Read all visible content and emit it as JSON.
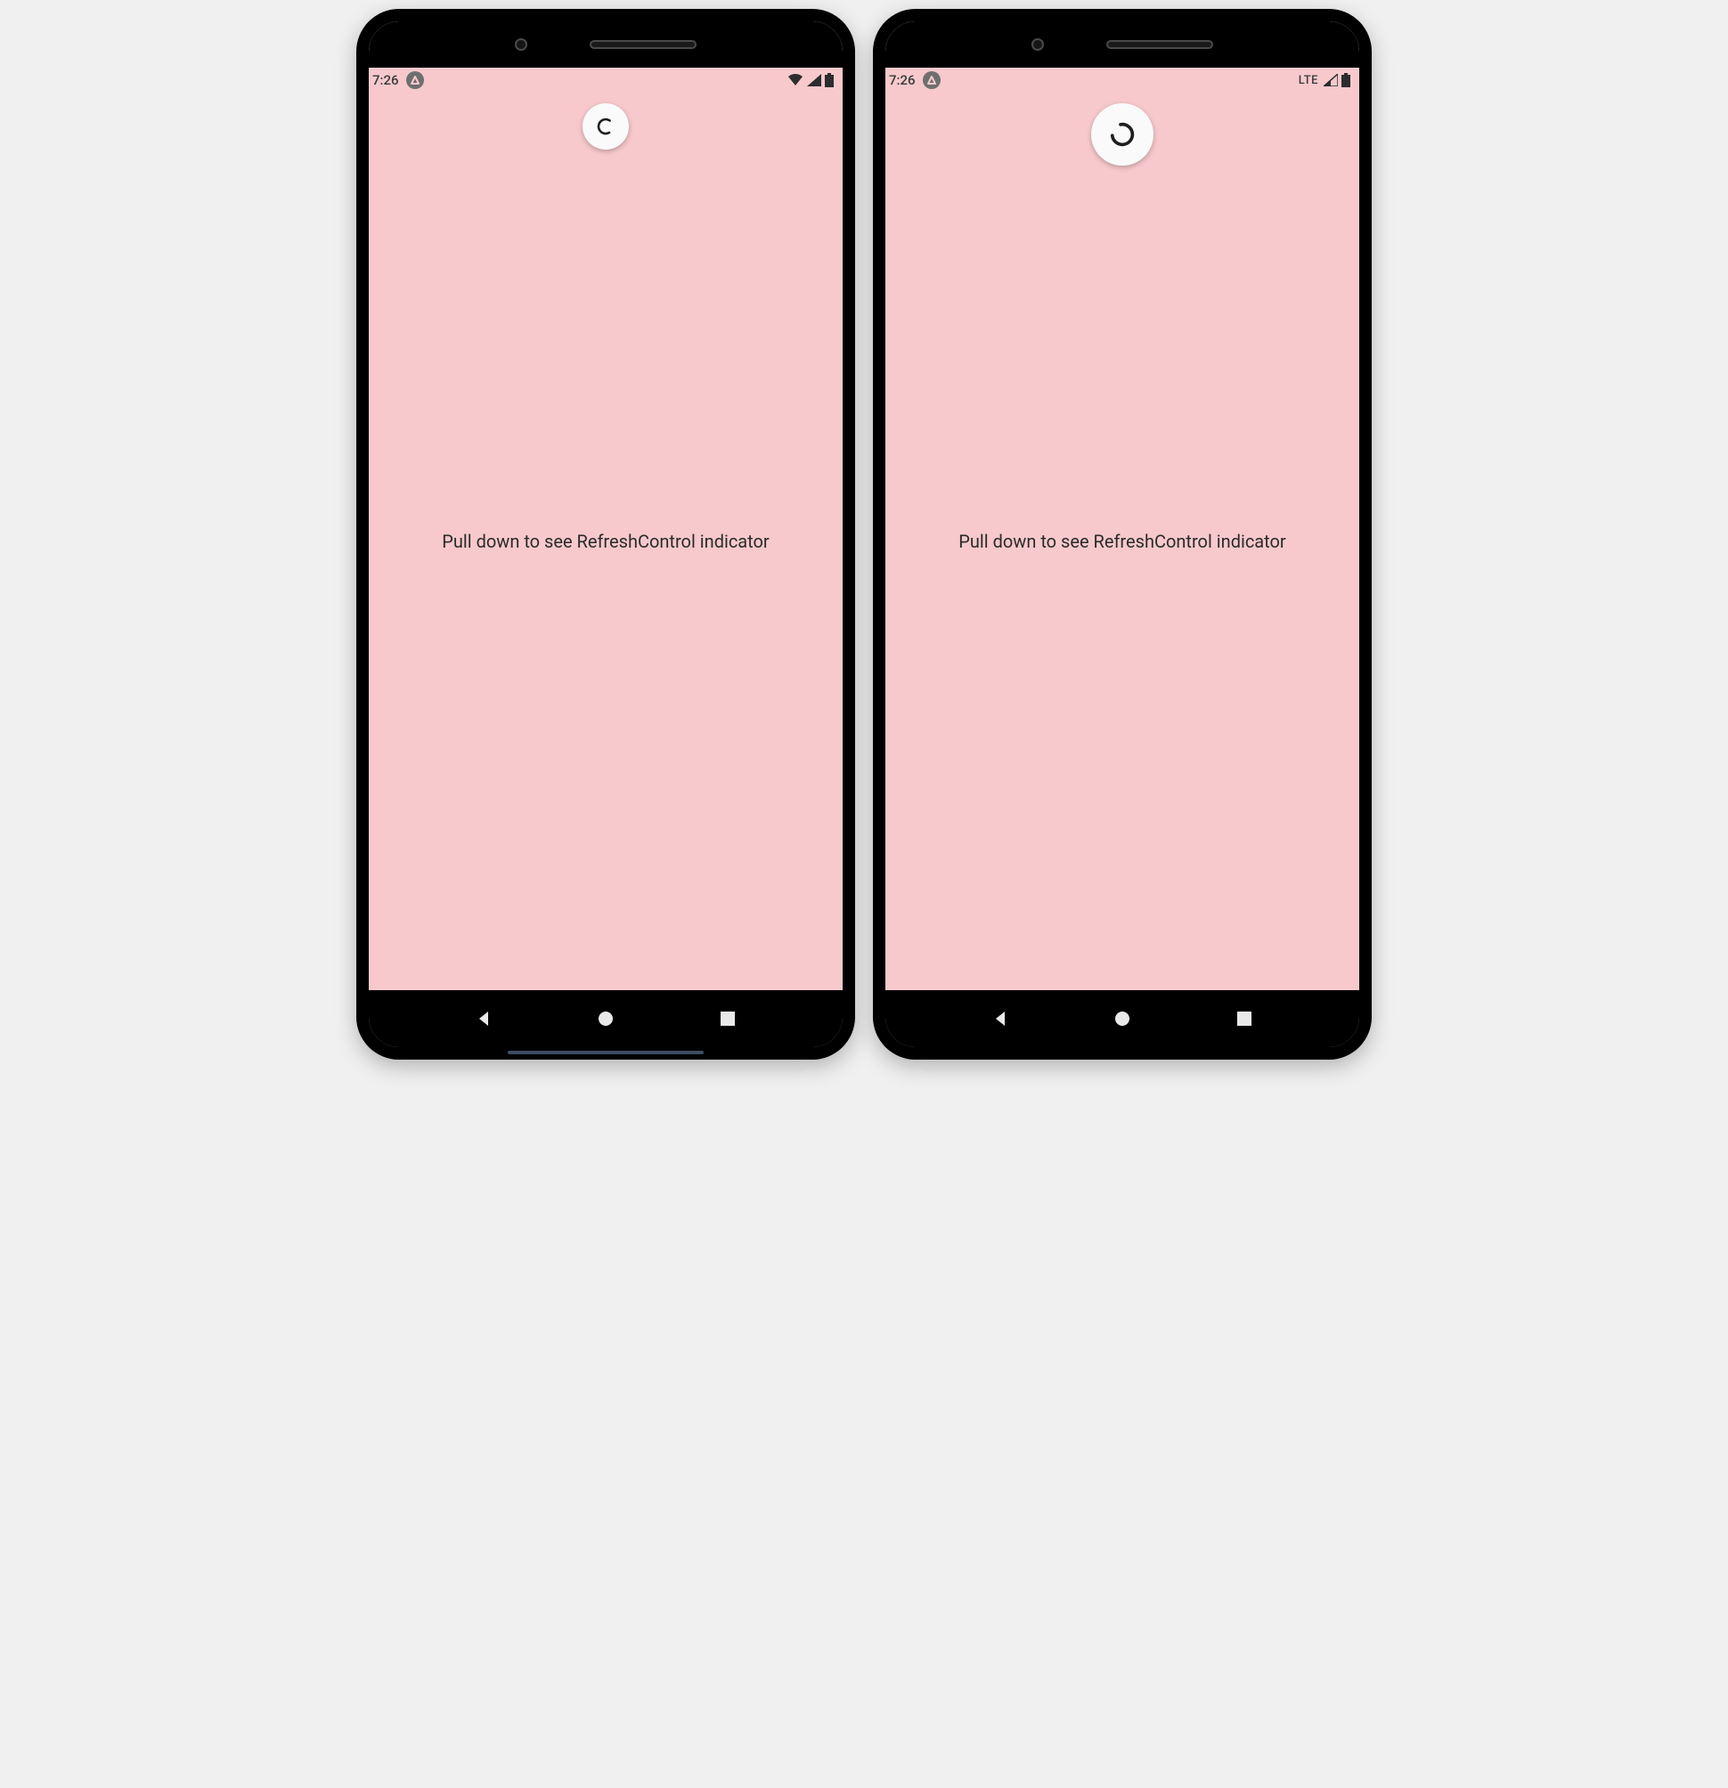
{
  "phones": [
    {
      "status": {
        "time": "7:26",
        "badge": "^",
        "right_mode": "wifi"
      },
      "refresh": {
        "size": "small"
      },
      "hint": "Pull down to see RefreshControl indicator",
      "show_home_indicator": true
    },
    {
      "status": {
        "time": "7:26",
        "badge": "^",
        "right_mode": "lte",
        "lte_label": "LTE"
      },
      "refresh": {
        "size": "large"
      },
      "hint": "Pull down to see RefreshControl indicator",
      "show_home_indicator": false
    }
  ],
  "colors": {
    "app_bg": "#f7c9cc",
    "text": "#2b2b2b"
  }
}
